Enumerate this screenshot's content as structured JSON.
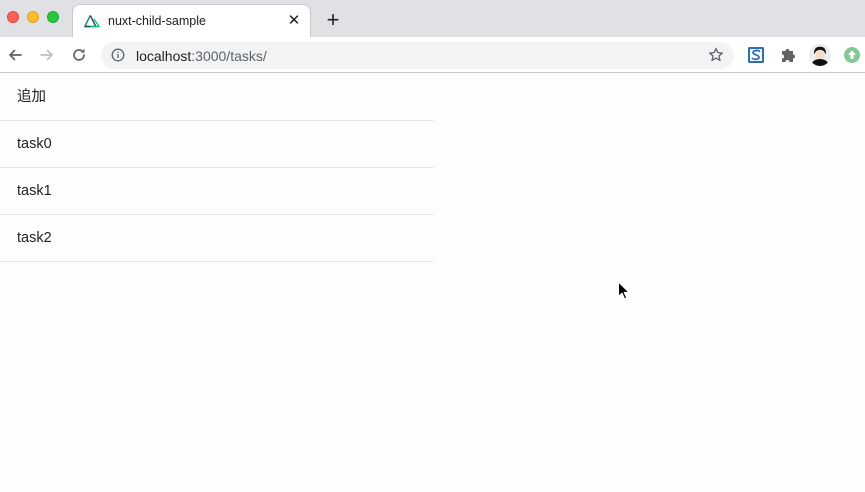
{
  "browser": {
    "tab": {
      "title": "nuxt-child-sample",
      "close_glyph": "✕",
      "favicon": "nuxt-logo-icon"
    },
    "new_tab_glyph": "+",
    "address": {
      "host": "localhost",
      "path": ":3000/tasks/"
    },
    "icons": [
      "back-arrow-icon",
      "forward-arrow-icon",
      "reload-icon",
      "info-icon",
      "star-icon",
      "extension-s-icon",
      "puzzle-icon",
      "avatar",
      "update-icon"
    ]
  },
  "tasks": {
    "add_label": "追加",
    "items": [
      {
        "label": "task0"
      },
      {
        "label": "task1"
      },
      {
        "label": "task2"
      }
    ]
  },
  "colors": {
    "traffic_close": "#fe5f57",
    "traffic_min": "#febc2e",
    "traffic_max": "#28c840",
    "nuxt_green": "#00c58e",
    "update_green": "#81c995"
  }
}
